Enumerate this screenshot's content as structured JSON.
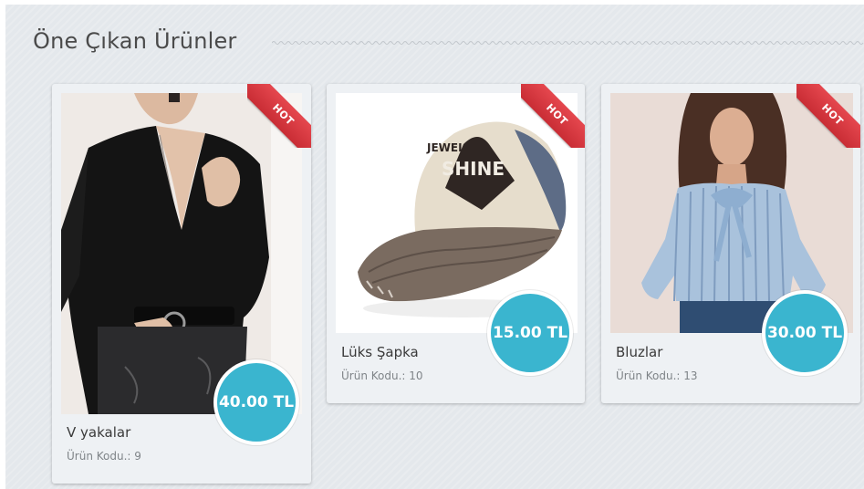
{
  "section": {
    "title": "Öne Çıkan Ürünler"
  },
  "colors": {
    "price_badge": "#3ab5cf",
    "hot_ribbon": "#d9363e",
    "panel_bg": "#e4e8ec"
  },
  "products": [
    {
      "name": "V yakalar",
      "code_label": "Ürün Kodu.: 9",
      "price": "40.00 TL",
      "badge": "HOT",
      "image": "black-v-neck-top-photo"
    },
    {
      "name": "Lüks Şapka",
      "code_label": "Ürün Kodu.: 10",
      "price": "15.00 TL",
      "badge": "HOT",
      "image": "jewel-shine-cap-photo",
      "cap_text": {
        "line1": "JEWEL",
        "line2": "SHINE"
      }
    },
    {
      "name": "Bluzlar",
      "code_label": "Ürün Kodu.: 13",
      "price": "30.00 TL",
      "badge": "HOT",
      "image": "striped-blouse-photo"
    }
  ]
}
